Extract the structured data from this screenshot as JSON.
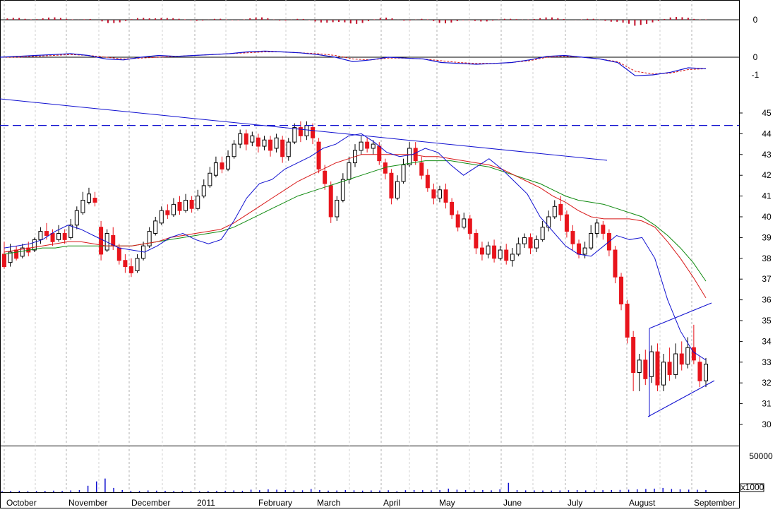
{
  "chart_data": {
    "type": "candlestick",
    "months": [
      "October",
      "November",
      "December",
      "2011",
      "February",
      "March",
      "April",
      "May",
      "June",
      "July",
      "August",
      "September"
    ],
    "price_axis": {
      "ticks": [
        "45",
        "44",
        "43",
        "42",
        "41",
        "40",
        "39",
        "38",
        "37",
        "36",
        "35",
        "34",
        "33",
        "32",
        "31",
        "30"
      ],
      "ylim": [
        29.5,
        45.5
      ]
    },
    "macd_hist_axis": {
      "ticks": [
        "0"
      ]
    },
    "macd_axis": {
      "ticks": [
        "0",
        "-1"
      ]
    },
    "volume_axis": {
      "ticks": [
        "50000"
      ],
      "unit": "x1000"
    },
    "resistance_level": 44.4,
    "colors": {
      "up": "#ffffff",
      "down": "#e8141c",
      "ma_short": "#1010d0",
      "ma_mid": "#d81818",
      "ma_long": "#108a10",
      "trendline": "#1010d0",
      "grid": "#b0b0b0",
      "volume": "#1010d0",
      "histogram": "#c0102a"
    },
    "ma_short": [
      38.5,
      38.6,
      38.7,
      38.9,
      39.3,
      39.6,
      39.4,
      39.1,
      38.8,
      38.5,
      38.4,
      38.3,
      38.6,
      39.0,
      39.2,
      38.9,
      38.7,
      38.9,
      39.8,
      40.9,
      41.6,
      41.8,
      42.3,
      42.6,
      42.9,
      43.3,
      43.5,
      43.9,
      44.0,
      43.6,
      43.1,
      42.9,
      43.0,
      43.3,
      43.1,
      42.5,
      42.0,
      42.4,
      42.8,
      42.3,
      41.7,
      41.1,
      40.0,
      39.3,
      38.6,
      38.2,
      38.1,
      38.6,
      39.1,
      38.9,
      39.0,
      38.0,
      36.0,
      34.5,
      33.5,
      33.1
    ],
    "ma_mid": [
      38.3,
      38.4,
      38.5,
      38.6,
      38.7,
      38.8,
      38.8,
      38.7,
      38.6,
      38.6,
      38.6,
      38.7,
      38.8,
      39.0,
      39.1,
      39.2,
      39.3,
      39.4,
      39.7,
      40.1,
      40.5,
      40.9,
      41.3,
      41.7,
      42.0,
      42.3,
      42.6,
      42.8,
      43.0,
      43.0,
      43.0,
      43.0,
      43.0,
      42.9,
      42.9,
      42.8,
      42.7,
      42.6,
      42.5,
      42.3,
      42.0,
      41.7,
      41.4,
      41.0,
      40.7,
      40.3,
      40.0,
      39.9,
      39.9,
      39.9,
      39.8,
      39.5,
      38.8,
      38.0,
      37.1,
      36.1
    ],
    "ma_long": [
      38.2,
      38.3,
      38.4,
      38.5,
      38.5,
      38.6,
      38.6,
      38.6,
      38.6,
      38.6,
      38.6,
      38.7,
      38.8,
      38.9,
      39.0,
      39.1,
      39.2,
      39.3,
      39.5,
      39.8,
      40.1,
      40.4,
      40.7,
      41.0,
      41.2,
      41.4,
      41.6,
      41.8,
      42.0,
      42.2,
      42.4,
      42.5,
      42.6,
      42.7,
      42.7,
      42.7,
      42.6,
      42.5,
      42.4,
      42.2,
      42.0,
      41.8,
      41.6,
      41.3,
      41.0,
      40.8,
      40.7,
      40.6,
      40.4,
      40.2,
      40.0,
      39.6,
      39.1,
      38.5,
      37.8,
      36.9
    ],
    "macd": [
      0.0,
      0.05,
      0.1,
      0.15,
      0.2,
      0.1,
      -0.1,
      -0.15,
      0.0,
      0.1,
      0.05,
      0.1,
      0.15,
      0.2,
      0.3,
      0.35,
      0.3,
      0.25,
      0.15,
      0.0,
      -0.25,
      -0.15,
      0.0,
      -0.05,
      -0.1,
      -0.3,
      -0.35,
      -0.4,
      -0.35,
      -0.3,
      -0.15,
      0.05,
      0.1,
      0.0,
      -0.1,
      -0.3,
      -1.05,
      -1.0,
      -0.85,
      -0.6,
      -0.65
    ],
    "macd_signal": [
      0.0,
      0.0,
      0.05,
      0.1,
      0.15,
      0.1,
      0.0,
      -0.1,
      -0.05,
      0.0,
      0.05,
      0.1,
      0.15,
      0.2,
      0.25,
      0.3,
      0.3,
      0.25,
      0.2,
      0.1,
      -0.1,
      -0.15,
      -0.05,
      -0.05,
      -0.1,
      -0.2,
      -0.3,
      -0.35,
      -0.35,
      -0.3,
      -0.2,
      0.0,
      0.05,
      0.0,
      -0.1,
      -0.25,
      -0.8,
      -0.95,
      -0.9,
      -0.7,
      -0.65
    ],
    "volume": [
      1500,
      1800,
      2000,
      1600,
      1700,
      1900,
      2200,
      1800,
      2500,
      3000,
      9000,
      15000,
      19000,
      6000,
      3000,
      2000,
      1800,
      2500,
      2200,
      2000,
      1800,
      1700,
      1600,
      1500,
      1800,
      2000,
      2100,
      2500,
      2000,
      3500,
      2800,
      4000,
      3500,
      3000,
      2500,
      2600,
      4500,
      3000,
      2200,
      2400,
      3000,
      2600,
      2200,
      2500,
      2400,
      2700,
      1600,
      2800,
      3000,
      2800,
      2600,
      3000,
      5000,
      3500,
      3000,
      2500,
      3000,
      2600,
      4000,
      13000,
      3000,
      2600,
      2500,
      2400,
      2300,
      2500,
      2800,
      3000,
      2600,
      2500,
      2800,
      3000,
      3200,
      3500,
      4000,
      4500,
      5000,
      6000,
      4500,
      4000,
      3600,
      3400,
      3000
    ],
    "candles": [
      [
        38.2,
        37.6,
        38.8,
        37.5
      ],
      [
        37.8,
        38.3,
        38.7,
        37.6
      ],
      [
        38.4,
        38.0,
        38.6,
        37.9
      ],
      [
        38.1,
        38.5,
        38.7,
        38.0
      ],
      [
        38.5,
        38.3,
        38.8,
        38.1
      ],
      [
        38.4,
        38.9,
        39.0,
        38.3
      ],
      [
        38.9,
        39.3,
        39.5,
        38.7
      ],
      [
        39.3,
        39.1,
        39.7,
        38.9
      ],
      [
        39.2,
        38.8,
        39.4,
        38.6
      ],
      [
        38.9,
        39.2,
        39.6,
        38.8
      ],
      [
        39.2,
        38.9,
        39.4,
        38.7
      ],
      [
        39.0,
        39.6,
        39.9,
        38.9
      ],
      [
        39.6,
        40.3,
        40.5,
        39.4
      ],
      [
        40.2,
        40.8,
        41.2,
        40.1
      ],
      [
        40.7,
        41.1,
        41.4,
        40.6
      ],
      [
        40.9,
        40.7,
        41.2,
        40.5
      ],
      [
        39.5,
        38.2,
        39.8,
        37.9
      ],
      [
        38.4,
        39.2,
        39.4,
        38.3
      ],
      [
        39.1,
        38.6,
        39.5,
        38.4
      ],
      [
        38.5,
        37.9,
        38.7,
        37.7
      ],
      [
        37.9,
        37.6,
        38.2,
        37.3
      ],
      [
        37.6,
        37.3,
        38.0,
        37.1
      ],
      [
        37.4,
        38.0,
        38.2,
        37.3
      ],
      [
        38.0,
        38.6,
        38.8,
        37.9
      ],
      [
        38.6,
        39.3,
        39.5,
        38.5
      ],
      [
        39.2,
        39.8,
        40.0,
        39.1
      ],
      [
        39.7,
        40.3,
        40.5,
        39.6
      ],
      [
        40.3,
        40.1,
        40.6,
        39.9
      ],
      [
        40.1,
        40.6,
        40.9,
        40.0
      ],
      [
        40.7,
        40.3,
        41.0,
        40.1
      ],
      [
        40.3,
        40.8,
        41.1,
        40.2
      ],
      [
        40.8,
        40.4,
        41.0,
        40.2
      ],
      [
        40.4,
        41.0,
        41.3,
        40.3
      ],
      [
        41.0,
        41.5,
        41.8,
        40.9
      ],
      [
        41.5,
        42.1,
        42.4,
        41.4
      ],
      [
        42.0,
        42.6,
        42.9,
        41.9
      ],
      [
        42.6,
        42.3,
        42.9,
        42.1
      ],
      [
        42.3,
        42.9,
        43.2,
        42.2
      ],
      [
        42.9,
        43.5,
        43.7,
        42.8
      ],
      [
        43.5,
        44.0,
        44.2,
        43.3
      ],
      [
        44.0,
        43.5,
        44.2,
        43.2
      ],
      [
        43.6,
        43.9,
        44.1,
        43.4
      ],
      [
        43.8,
        43.4,
        44.0,
        43.1
      ],
      [
        43.4,
        43.7,
        43.9,
        43.2
      ],
      [
        43.7,
        43.2,
        43.9,
        42.9
      ],
      [
        43.3,
        43.8,
        44.0,
        43.1
      ],
      [
        43.7,
        42.9,
        43.9,
        42.6
      ],
      [
        42.9,
        43.6,
        43.8,
        42.7
      ],
      [
        43.6,
        44.3,
        44.5,
        43.5
      ],
      [
        44.3,
        43.9,
        44.6,
        43.6
      ],
      [
        43.9,
        44.4,
        44.6,
        43.7
      ],
      [
        44.3,
        43.8,
        44.5,
        43.5
      ],
      [
        43.6,
        42.3,
        43.8,
        42.1
      ],
      [
        42.2,
        41.6,
        42.5,
        41.3
      ],
      [
        41.5,
        40.0,
        41.7,
        39.7
      ],
      [
        40.0,
        40.8,
        41.0,
        39.8
      ],
      [
        40.8,
        41.8,
        42.1,
        40.7
      ],
      [
        41.8,
        42.6,
        42.9,
        41.6
      ],
      [
        42.6,
        43.2,
        43.5,
        42.4
      ],
      [
        43.2,
        43.6,
        43.9,
        43.0
      ],
      [
        43.6,
        43.3,
        43.8,
        43.1
      ],
      [
        43.3,
        43.5,
        43.7,
        43.0
      ],
      [
        43.4,
        42.7,
        43.6,
        42.5
      ],
      [
        42.6,
        42.1,
        42.8,
        41.8
      ],
      [
        42.1,
        40.9,
        42.3,
        40.6
      ],
      [
        40.9,
        41.7,
        42.0,
        40.8
      ],
      [
        41.7,
        42.5,
        42.8,
        41.6
      ],
      [
        42.5,
        43.3,
        43.6,
        42.4
      ],
      [
        43.3,
        42.7,
        43.6,
        42.5
      ],
      [
        42.6,
        42.0,
        42.9,
        41.8
      ],
      [
        42.0,
        41.4,
        42.3,
        41.2
      ],
      [
        41.3,
        40.9,
        41.6,
        40.6
      ],
      [
        40.9,
        41.3,
        41.5,
        40.7
      ],
      [
        41.3,
        40.7,
        41.6,
        40.4
      ],
      [
        40.7,
        40.1,
        40.9,
        39.9
      ],
      [
        40.1,
        39.5,
        40.3,
        39.3
      ],
      [
        39.5,
        39.9,
        40.2,
        39.4
      ],
      [
        39.9,
        39.2,
        40.1,
        38.9
      ],
      [
        39.2,
        38.5,
        39.4,
        38.2
      ],
      [
        38.5,
        38.2,
        38.8,
        37.9
      ],
      [
        38.2,
        38.6,
        38.8,
        38.0
      ],
      [
        38.6,
        38.0,
        38.9,
        37.8
      ],
      [
        38.0,
        38.4,
        38.6,
        37.9
      ],
      [
        38.4,
        37.9,
        38.7,
        37.7
      ],
      [
        37.9,
        38.2,
        38.5,
        37.6
      ],
      [
        38.2,
        38.7,
        39.0,
        38.1
      ],
      [
        38.7,
        39.0,
        39.2,
        38.5
      ],
      [
        39.0,
        38.5,
        39.2,
        38.2
      ],
      [
        38.5,
        38.9,
        39.1,
        38.3
      ],
      [
        38.9,
        39.5,
        39.8,
        38.8
      ],
      [
        39.5,
        40.0,
        40.3,
        39.3
      ],
      [
        40.0,
        40.5,
        40.8,
        39.9
      ],
      [
        40.6,
        40.1,
        41.0,
        39.8
      ],
      [
        40.1,
        39.3,
        40.3,
        39.0
      ],
      [
        39.3,
        38.7,
        39.6,
        38.4
      ],
      [
        38.7,
        38.2,
        38.9,
        38.0
      ],
      [
        38.2,
        38.5,
        38.8,
        38.0
      ],
      [
        38.5,
        39.2,
        39.6,
        38.4
      ],
      [
        39.2,
        39.7,
        39.9,
        39.0
      ],
      [
        39.6,
        39.2,
        39.8,
        38.9
      ],
      [
        39.2,
        38.4,
        39.4,
        38.1
      ],
      [
        38.4,
        37.1,
        38.6,
        36.8
      ],
      [
        37.1,
        35.8,
        37.3,
        35.5
      ],
      [
        35.8,
        34.2,
        36.0,
        33.9
      ],
      [
        34.2,
        32.5,
        34.5,
        31.6
      ],
      [
        32.5,
        33.1,
        33.4,
        31.6
      ],
      [
        33.1,
        32.2,
        33.6,
        31.9
      ],
      [
        32.3,
        33.5,
        33.8,
        32.0
      ],
      [
        33.5,
        31.9,
        33.9,
        31.6
      ],
      [
        31.9,
        33.0,
        33.4,
        31.6
      ],
      [
        33.0,
        32.4,
        33.7,
        32.1
      ],
      [
        32.4,
        33.4,
        33.9,
        32.2
      ],
      [
        33.4,
        32.9,
        34.0,
        32.6
      ],
      [
        32.9,
        33.7,
        34.2,
        32.7
      ],
      [
        33.7,
        33.1,
        34.8,
        32.9
      ],
      [
        33.0,
        32.1,
        33.3,
        31.8
      ],
      [
        32.1,
        32.9,
        33.2,
        31.8
      ]
    ],
    "volume_labels": {
      "unit_label": "x1000"
    }
  }
}
